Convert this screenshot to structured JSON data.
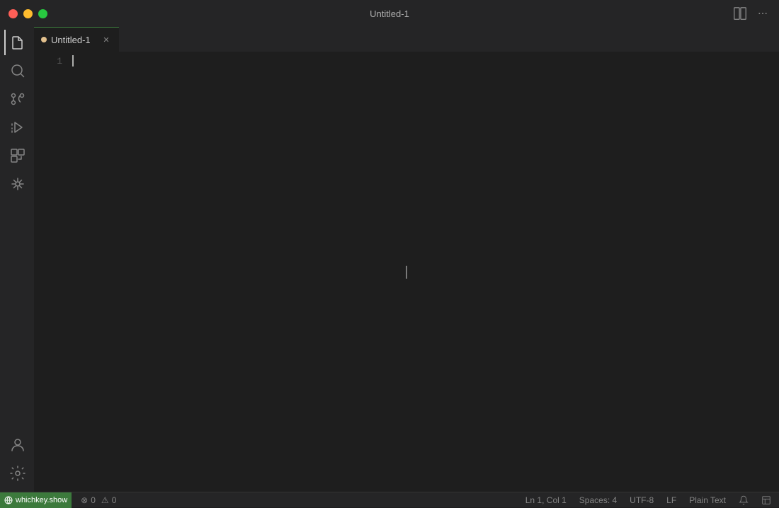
{
  "titlebar": {
    "title": "Untitled-1",
    "traffic_lights": {
      "close_label": "close",
      "minimize_label": "minimize",
      "maximize_label": "maximize"
    }
  },
  "tab": {
    "filename": "Untitled-1",
    "modified": true
  },
  "editor": {
    "line_number": "1",
    "content": ""
  },
  "activity_bar": {
    "items": [
      {
        "id": "explorer",
        "label": "Explorer",
        "active": true
      },
      {
        "id": "search",
        "label": "Search",
        "active": false
      },
      {
        "id": "source-control",
        "label": "Source Control",
        "active": false
      },
      {
        "id": "run",
        "label": "Run and Debug",
        "active": false
      },
      {
        "id": "extensions",
        "label": "Extensions",
        "active": false
      },
      {
        "id": "source-control-2",
        "label": "Remote Explorer",
        "active": false
      }
    ],
    "bottom_items": [
      {
        "id": "account",
        "label": "Account"
      },
      {
        "id": "settings",
        "label": "Settings"
      }
    ]
  },
  "status_bar": {
    "remote": "whichkey.show",
    "errors": "0",
    "warnings": "0",
    "line_col": "Ln 1, Col 1",
    "spaces": "Spaces: 4",
    "encoding": "UTF-8",
    "line_ending": "LF",
    "language": "Plain Text",
    "notifications_icon": "bell",
    "layout_icon": "layout"
  }
}
